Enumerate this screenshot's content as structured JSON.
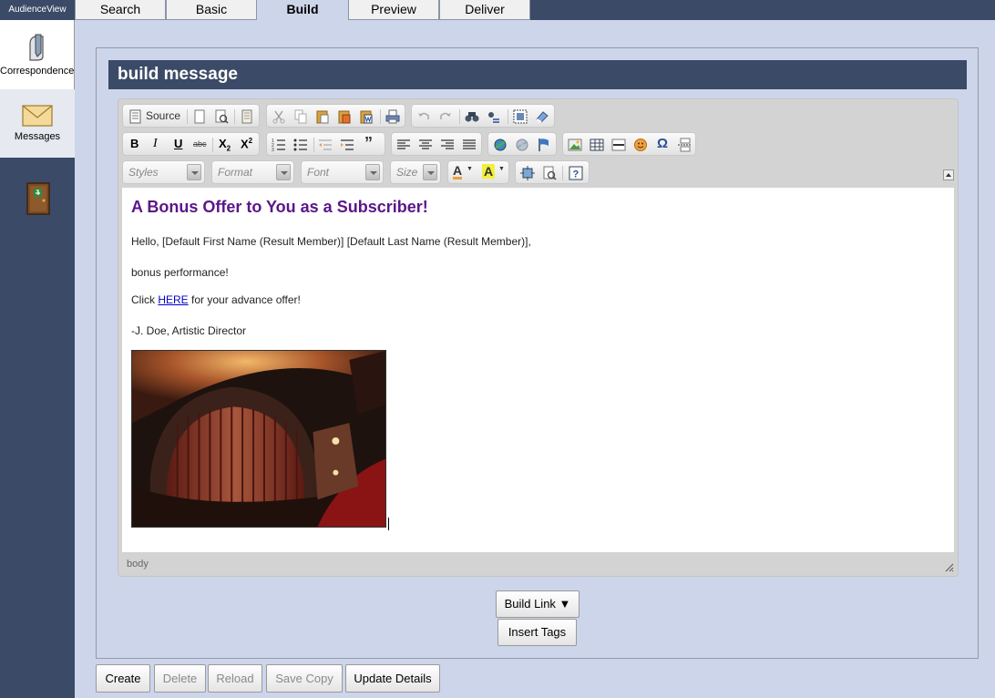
{
  "app": {
    "title": "AudienceView"
  },
  "tabs": [
    {
      "label": "Search",
      "active": false
    },
    {
      "label": "Basic",
      "active": false
    },
    {
      "label": "Build",
      "active": true
    },
    {
      "label": "Preview",
      "active": false
    },
    {
      "label": "Deliver",
      "active": false
    }
  ],
  "sidebar": {
    "items": [
      {
        "label": "Correspondence",
        "icon": "correspondence-icon",
        "active": true
      },
      {
        "label": "Messages",
        "icon": "envelope-icon",
        "active": false
      },
      {
        "label": "",
        "icon": "exit-door-icon"
      }
    ]
  },
  "panel": {
    "title": "build message"
  },
  "toolbar": {
    "source_label": "Source",
    "styles_placeholder": "Styles",
    "format_placeholder": "Format",
    "font_placeholder": "Font",
    "size_placeholder": "Size"
  },
  "message": {
    "heading": "A Bonus Offer to You as a Subscriber!",
    "greeting": "Hello, [Default First Name (Result Member)] [Default Last Name (Result Member)],",
    "line2": "bonus performance!",
    "click_prefix": "Click ",
    "link_text": "HERE",
    "click_suffix": " for your advance offer!",
    "signature": "-J. Doe, Artistic Director",
    "image": "theatre-interior-photo"
  },
  "status": {
    "path": "body"
  },
  "actions": {
    "build_link": "Build Link ▼",
    "insert_tags": "Insert Tags"
  },
  "footer_buttons": [
    {
      "label": "Create",
      "enabled": true
    },
    {
      "label": "Delete",
      "enabled": false
    },
    {
      "label": "Reload",
      "enabled": false
    },
    {
      "label": "Save Copy",
      "enabled": false
    },
    {
      "label": "Update Details",
      "enabled": true
    }
  ],
  "colors": {
    "nav_bg": "#3b4a66",
    "page_bg": "#ccd5ea",
    "heading": "#5b1688",
    "link": "#0000cc"
  }
}
